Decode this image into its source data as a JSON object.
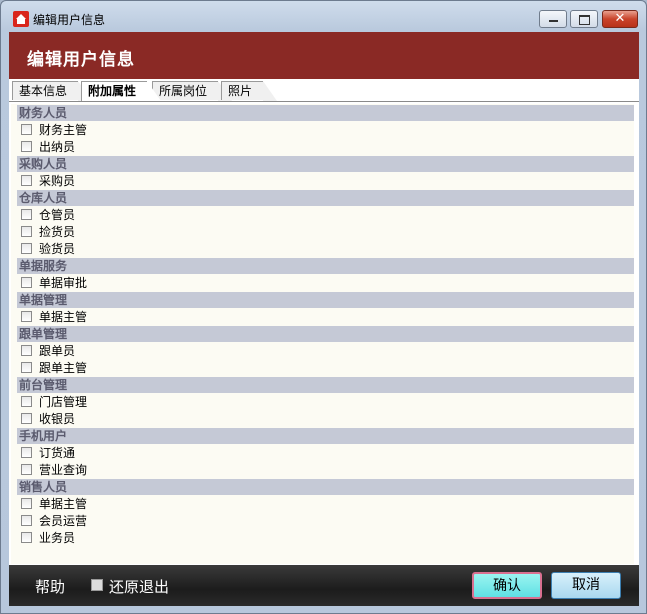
{
  "window": {
    "title": "编辑用户信息"
  },
  "header": {
    "title": "编辑用户信息"
  },
  "tabs": [
    {
      "label": "基本信息",
      "active": false
    },
    {
      "label": "附加属性",
      "active": true
    },
    {
      "label": "所属岗位",
      "active": false
    },
    {
      "label": "照片",
      "active": false
    }
  ],
  "sections": [
    {
      "title": "财务人员",
      "items": [
        "财务主管",
        "出纳员"
      ]
    },
    {
      "title": "采购人员",
      "items": [
        "采购员"
      ]
    },
    {
      "title": "仓库人员",
      "items": [
        "仓管员",
        "捡货员",
        "验货员"
      ]
    },
    {
      "title": "单据服务",
      "items": [
        "单据审批"
      ]
    },
    {
      "title": "单据管理",
      "items": [
        "单据主管"
      ]
    },
    {
      "title": "跟单管理",
      "items": [
        "跟单员",
        "跟单主管"
      ]
    },
    {
      "title": "前台管理",
      "items": [
        "门店管理",
        "收银员"
      ]
    },
    {
      "title": "手机用户",
      "items": [
        "订货通",
        "营业查询"
      ]
    },
    {
      "title": "销售人员",
      "items": [
        "单据主管",
        "会员运营",
        "业务员"
      ]
    }
  ],
  "footer": {
    "help_label": "帮助",
    "restore_label": "还原退出",
    "ok_label": "确认",
    "cancel_label": "取消"
  },
  "colors": {
    "header": "#8a2925",
    "section": "#c5c9d6",
    "panel": "#fcfbf3",
    "footer": "#1c1c1c"
  }
}
